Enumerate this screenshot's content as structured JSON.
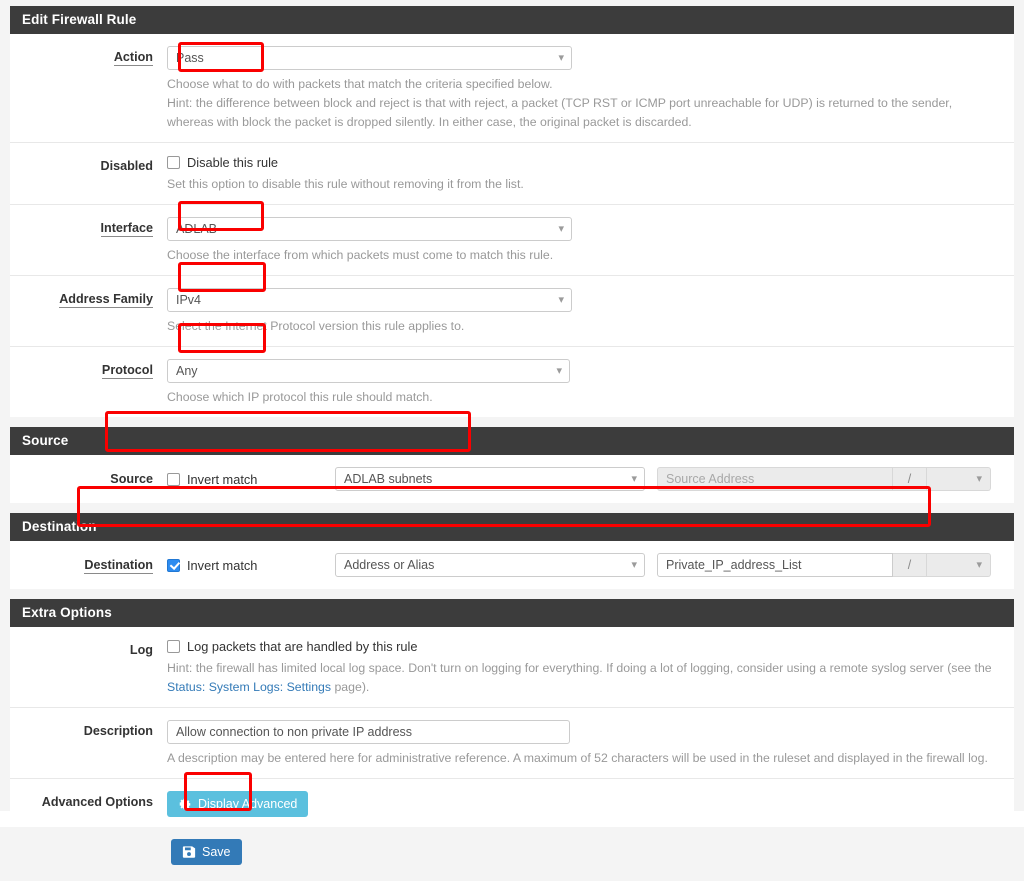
{
  "sections": {
    "edit_rule": "Edit Firewall Rule",
    "source": "Source",
    "destination": "Destination",
    "extra_options": "Extra Options"
  },
  "fields": {
    "action": {
      "label": "Action",
      "value": "Pass",
      "hint_line1": "Choose what to do with packets that match the criteria specified below.",
      "hint_line2": "Hint: the difference between block and reject is that with reject, a packet (TCP RST or ICMP port unreachable for UDP) is returned to the sender,",
      "hint_line3": "whereas with block the packet is dropped silently. In either case, the original packet is discarded."
    },
    "disabled": {
      "label": "Disabled",
      "checkbox_label": "Disable this rule",
      "checked": false,
      "hint": "Set this option to disable this rule without removing it from the list."
    },
    "interface": {
      "label": "Interface",
      "value": "ADLAB",
      "hint": "Choose the interface from which packets must come to match this rule."
    },
    "address_family": {
      "label": "Address Family",
      "value": "IPv4",
      "hint": "Select the Internet Protocol version this rule applies to."
    },
    "protocol": {
      "label": "Protocol",
      "value": "Any",
      "hint": "Choose which IP protocol this rule should match."
    },
    "source": {
      "label": "Source",
      "invert_label": "Invert match",
      "invert_checked": false,
      "type_value": "ADLAB subnets",
      "address_placeholder": "Source Address",
      "slash": "/",
      "mask_value": ""
    },
    "destination": {
      "label": "Destination",
      "invert_label": "Invert match",
      "invert_checked": true,
      "type_value": "Address or Alias",
      "address_value": "Private_IP_address_List",
      "slash": "/",
      "mask_value": ""
    },
    "log": {
      "label": "Log",
      "checkbox_label": "Log packets that are handled by this rule",
      "checked": false,
      "hint_before": "Hint: the firewall has limited local log space. Don't turn on logging for everything. If doing a lot of logging, consider using a remote syslog server (see the ",
      "hint_link": "Status: System Logs: Settings",
      "hint_after": " page)."
    },
    "description": {
      "label": "Description",
      "value": "Allow connection to non private IP address",
      "hint": "A description may be entered here for administrative reference. A maximum of 52 characters will be used in the ruleset and displayed in the firewall log."
    },
    "advanced_options": {
      "label": "Advanced Options",
      "button_label": "Display Advanced"
    }
  },
  "buttons": {
    "save_label": "Save"
  },
  "colors": {
    "annotation": "#fa0000",
    "panel_heading_bg": "#3c3c3c",
    "primary": "#337ab7",
    "info": "#5bc0de",
    "link": "#337ab7",
    "checkbox_checked": "#2d8cf0"
  }
}
